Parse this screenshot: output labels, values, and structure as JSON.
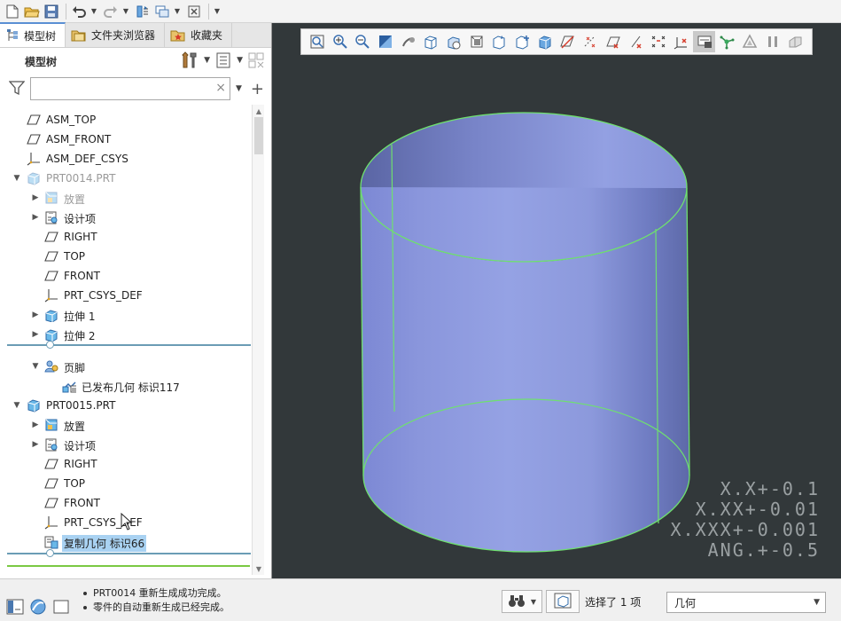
{
  "tabs": [
    {
      "label": "模型树",
      "icon": "model-tree-icon"
    },
    {
      "label": "文件夹浏览器",
      "icon": "folder-icon"
    },
    {
      "label": "收藏夹",
      "icon": "favorites-icon"
    }
  ],
  "tree_header": {
    "label": "模型树"
  },
  "filter": {
    "value": "",
    "placeholder": "",
    "clear": "×",
    "add": "+"
  },
  "tree": [
    {
      "label": "ASM_TOP",
      "icon": "datum-plane-icon"
    },
    {
      "label": "ASM_FRONT",
      "icon": "datum-plane-icon"
    },
    {
      "label": "ASM_DEF_CSYS",
      "icon": "csys-icon"
    },
    {
      "label": "PRT0014.PRT",
      "icon": "part-icon",
      "expanded": true
    },
    {
      "label": "放置",
      "icon": "placement-icon"
    },
    {
      "label": "设计项",
      "icon": "design-items-icon"
    },
    {
      "label": "RIGHT",
      "icon": "datum-plane-icon"
    },
    {
      "label": "TOP",
      "icon": "datum-plane-icon"
    },
    {
      "label": "FRONT",
      "icon": "datum-plane-icon"
    },
    {
      "label": "PRT_CSYS_DEF",
      "icon": "csys-icon"
    },
    {
      "label": "拉伸 1",
      "icon": "extrude-icon"
    },
    {
      "label": "拉伸 2",
      "icon": "extrude-icon"
    },
    {
      "label": "页脚",
      "icon": "footer-icon",
      "expanded": true
    },
    {
      "label": "已发布几何 标识117",
      "icon": "published-geometry-icon"
    },
    {
      "label": "PRT0015.PRT",
      "icon": "part-icon",
      "expanded": true
    },
    {
      "label": "放置",
      "icon": "placement-icon"
    },
    {
      "label": "设计项",
      "icon": "design-items-icon"
    },
    {
      "label": "RIGHT",
      "icon": "datum-plane-icon"
    },
    {
      "label": "TOP",
      "icon": "datum-plane-icon"
    },
    {
      "label": "FRONT",
      "icon": "datum-plane-icon"
    },
    {
      "label": "PRT_CSYS_DEF",
      "icon": "csys-icon"
    },
    {
      "label": "复制几何 标识66",
      "icon": "copy-geometry-icon",
      "selected": true
    }
  ],
  "graphics": {
    "background": "#32383a",
    "model_fill": "#8e9bdf",
    "edge_color": "#6fe06f",
    "tolerances": [
      "X.X+-0.1",
      "X.XX+-0.01",
      "X.XXX+-0.001",
      "ANG.+-0.5"
    ]
  },
  "status": {
    "messages": [
      "PRT0014 重新生成成功完成。",
      "零件的自动重新生成已经完成。"
    ],
    "selection_count": "选择了 1 项",
    "filter_value": "几何"
  },
  "colors": {
    "accent": "#5a8fd4",
    "selection": "#a9d2f2",
    "insert_line": "#6b9cb5",
    "green_line": "#7ac943"
  }
}
